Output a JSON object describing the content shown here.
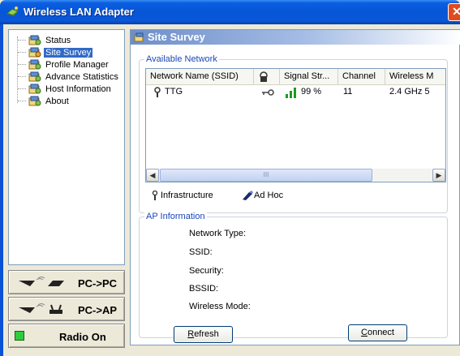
{
  "window": {
    "title": "Wireless LAN Adapter",
    "close_glyph": "✕"
  },
  "tree": {
    "items": [
      {
        "label": "Status",
        "icon": "status-icon"
      },
      {
        "label": "Site Survey",
        "icon": "site-survey-icon",
        "selected": true
      },
      {
        "label": "Profile Manager",
        "icon": "profile-manager-icon"
      },
      {
        "label": "Advance Statistics",
        "icon": "statistics-icon"
      },
      {
        "label": "Host Information",
        "icon": "host-info-icon"
      },
      {
        "label": "About",
        "icon": "about-icon"
      }
    ]
  },
  "side_buttons": {
    "pc_pc": "PC->PC",
    "pc_ap": "PC->AP",
    "radio": "Radio On"
  },
  "main": {
    "header": "Site Survey",
    "available_network": {
      "title": "Available Network",
      "columns": [
        "Network Name (SSID)",
        "",
        "Signal Str...",
        "Channel",
        "Wireless M"
      ],
      "rows": [
        {
          "ssid": "TTG",
          "signal": "99 %",
          "channel": "11",
          "mode": "2.4 GHz 5"
        }
      ],
      "thumb_grip": "III"
    },
    "legend": {
      "infrastructure": "Infrastructure",
      "adhoc": "Ad Hoc"
    },
    "ap_info": {
      "title": "AP Information",
      "labels": [
        "Network Type:",
        "SSID:",
        "Security:",
        "BSSID:",
        "Wireless Mode:"
      ]
    },
    "buttons": {
      "refresh_prefix": "R",
      "refresh_rest": "efresh",
      "connect_prefix": "C",
      "connect_rest": "onnect"
    }
  },
  "colors": {
    "titlebar": "#0655d6",
    "selection": "#316ac5",
    "group_title": "#1a47b8",
    "signal_green": "#1a9d1a",
    "radio_led": "#2ecc40"
  }
}
